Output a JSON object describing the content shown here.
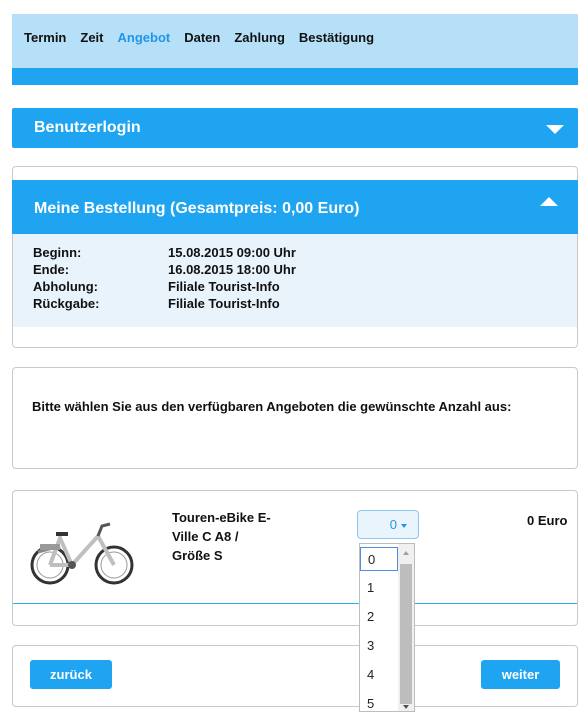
{
  "nav": {
    "steps": [
      "Termin",
      "Zeit",
      "Angebot",
      "Daten",
      "Zahlung",
      "Bestätigung"
    ]
  },
  "login_panel": {
    "title": "Benutzerlogin"
  },
  "order_panel": {
    "title": "Meine Bestellung (Gesamtpreis: 0,00 Euro)",
    "rows": [
      {
        "label": "Beginn:",
        "value": "15.08.2015 09:00 Uhr"
      },
      {
        "label": "Ende:",
        "value": "16.08.2015 18:00 Uhr"
      },
      {
        "label": "Abholung:",
        "value": "Filiale Tourist-Info"
      },
      {
        "label": "Rückgabe:",
        "value": "Filiale Tourist-Info"
      }
    ]
  },
  "instructions": "Bitte wählen Sie aus den verfügbaren Angeboten die gewünschte Anzahl aus:",
  "product": {
    "name_lines": [
      "Touren-eBike E-",
      "Ville C A8 /",
      "Größe S"
    ],
    "quantity": "0",
    "price": "0 Euro",
    "quantity_options": [
      "0",
      "1",
      "2",
      "3",
      "4",
      "5"
    ]
  },
  "buttons": {
    "back": "zurück",
    "next": "weiter"
  },
  "colors": {
    "accent": "#1ea4f0",
    "nav_bg": "#b6e0f8",
    "active_step": "#2196e8",
    "summary_bg": "#e9f3fc"
  }
}
